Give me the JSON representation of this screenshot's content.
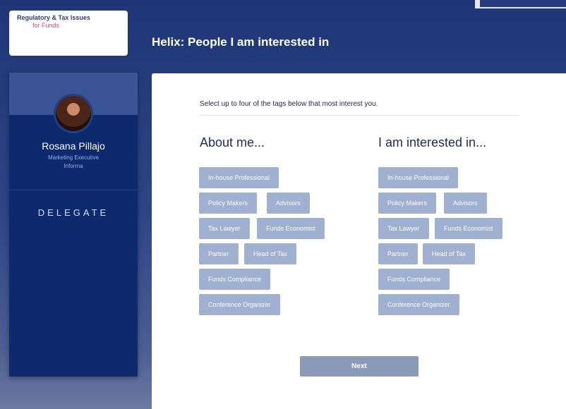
{
  "logo": {
    "line1": "Regulatory & Tax Issues",
    "line2": "for Funds"
  },
  "header": {
    "title": "Helix: People I am interested in"
  },
  "profile": {
    "name": "Rosana Pillajo",
    "role": "Marketing Executive",
    "company": "Informa",
    "type": "DELEGATE"
  },
  "main": {
    "instructions": "Select up to four of the tags below that most interest you.",
    "about_heading": "About me...",
    "interested_heading": "I am interested in...",
    "about_tags": [
      "In-house Professional",
      "Policy Makers",
      "Advisors",
      "Tax Lawyer",
      "Funds Economist",
      "Partner",
      "Head of Tax",
      "Funds Compliance",
      "Conference Organizer"
    ],
    "interested_tags": [
      "In-house Professional",
      "Policy Makers",
      "Advisors",
      "Tax Lawyer",
      "Funds Economist",
      "Partner",
      "Head of Tax",
      "Funds Compliance",
      "Conference Organizer"
    ],
    "next_label": "Next"
  },
  "colors": {
    "tag": "#9fb0d0",
    "button": "#8a9ab8",
    "sidebar": "#0d2a6d",
    "header": "#1f3576"
  }
}
